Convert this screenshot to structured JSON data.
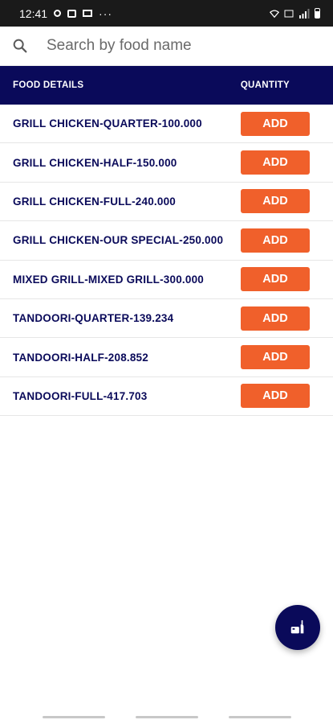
{
  "status_bar": {
    "time": "12:41",
    "icons": [
      "whatsapp-icon",
      "image-icon",
      "monitor-icon",
      "more-dots-icon",
      "wifi-icon",
      "volte-icon",
      "signal-icon",
      "battery-icon"
    ],
    "dots": "···"
  },
  "search": {
    "placeholder": "Search by food name",
    "value": ""
  },
  "table": {
    "col_food": "FOOD DETAILS",
    "col_quantity": "QUANTITY",
    "rows": [
      {
        "label": "GRILL CHICKEN-QUARTER-100.000",
        "button": "ADD"
      },
      {
        "label": "GRILL CHICKEN-HALF-150.000",
        "button": "ADD"
      },
      {
        "label": "GRILL CHICKEN-FULL-240.000",
        "button": "ADD"
      },
      {
        "label": "GRILL CHICKEN-OUR SPECIAL-250.000",
        "button": "ADD"
      },
      {
        "label": "MIXED GRILL-MIXED GRILL-300.000",
        "button": "ADD"
      },
      {
        "label": "TANDOORI-QUARTER-139.234",
        "button": "ADD"
      },
      {
        "label": "TANDOORI-HALF-208.852",
        "button": "ADD"
      },
      {
        "label": "TANDOORI-FULL-417.703",
        "button": "ADD"
      }
    ]
  },
  "fab": {
    "icon": "food-cart-icon"
  },
  "colors": {
    "header_bg": "#0a0a5a",
    "accent": "#f0602b",
    "text_primary": "#0a0a5a"
  }
}
